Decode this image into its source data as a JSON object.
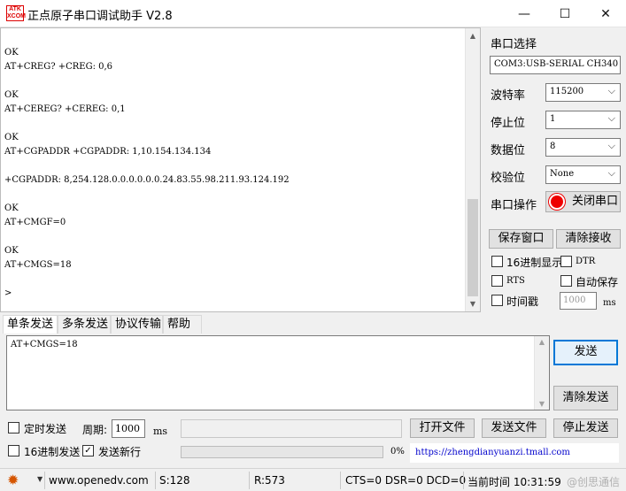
{
  "window": {
    "title": "正点原子串口调试助手 V2.8",
    "icon_text": "ATK\nXCOM",
    "min": "—",
    "max": "☐",
    "close": "✕"
  },
  "terminal": {
    "text": "OK\nAT+CREG? +CREG: 0,6\n\nOK\nAT+CEREG? +CEREG: 0,1\n\nOK\nAT+CGPADDR +CGPADDR: 1,10.154.134.134\n\n+CGPADDR: 8,254.128.0.0.0.0.0.0.24.83.55.98.211.93.124.192\n\nOK\nAT+CMGF=0\n\nOK\nAT+CMGS=18\n\n>"
  },
  "right_panel": {
    "port_select_label": "串口选择",
    "port_value": "COM3:USB-SERIAL CH340",
    "baud_label": "波特率",
    "baud_value": "115200",
    "stopbits_label": "停止位",
    "stopbits_value": "1",
    "databits_label": "数据位",
    "databits_value": "8",
    "parity_label": "校验位",
    "parity_value": "None",
    "port_op_label": "串口操作",
    "close_port_button": "关闭串口",
    "save_window_button": "保存窗口",
    "clear_receive_button": "清除接收",
    "hex_display_label": "16进制显示",
    "dtr_label": "DTR",
    "rts_label": "RTS",
    "auto_save_label": "自动保存",
    "timestamp_label": "时间戳",
    "timestamp_value": "1000",
    "timestamp_unit": "ms"
  },
  "tabs": [
    "单条发送",
    "多条发送",
    "协议传输",
    "帮助"
  ],
  "send": {
    "text": "AT+CMGS=18",
    "send_button": "发送",
    "clear_send_button": "清除发送",
    "timed_send_label": "定时发送",
    "period_label": "周期:",
    "period_value": "1000",
    "period_unit": "ms",
    "open_file_button": "打开文件",
    "send_file_button": "发送文件",
    "stop_send_button": "停止发送",
    "hex_send_label": "16进制发送",
    "send_newline_label": "发送新行",
    "send_newline_checked": "✓",
    "progress_text": "0%",
    "progress_value": 0,
    "link": "https://zhengdianyuanzi.tmall.com"
  },
  "statusbar": {
    "website": "www.openedv.com",
    "sent": "S:128",
    "received": "R:573",
    "lines": "CTS=0 DSR=0 DCD=0",
    "time": "当前时间 10:31:59",
    "watermark": "@创思通信"
  }
}
